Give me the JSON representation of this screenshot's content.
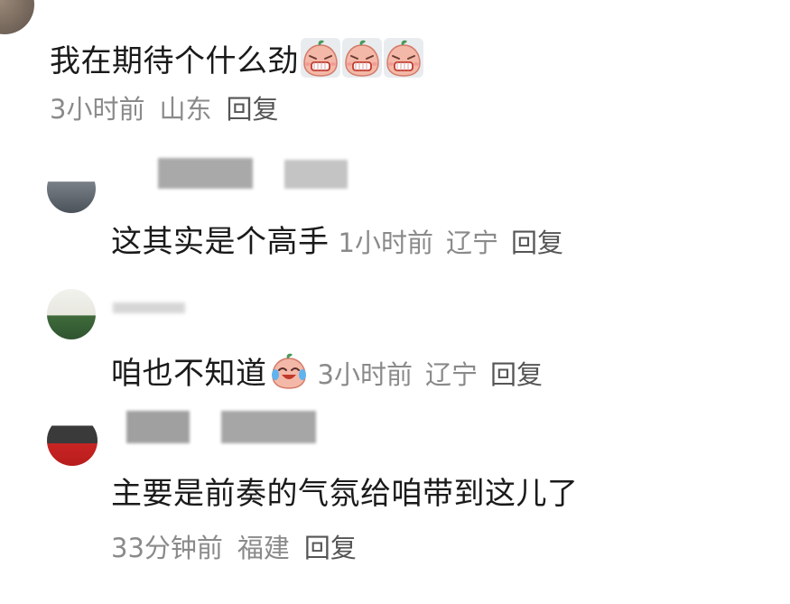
{
  "comments": [
    {
      "text": "我在期待个什么劲",
      "emojis": [
        "grimace-sticker",
        "grimace-sticker",
        "grimace-sticker"
      ],
      "time": "3小时前",
      "location": "山东",
      "reply": "回复"
    },
    {
      "text": "这其实是个高手",
      "time": "1小时前",
      "location": "辽宁",
      "reply": "回复"
    },
    {
      "text": "咱也不知道",
      "emojis": [
        "laugh-cry-sticker"
      ],
      "time": "3小时前",
      "location": "辽宁",
      "reply": "回复"
    },
    {
      "text": "主要是前奏的气氛给咱带到这儿了",
      "time": "33分钟前",
      "location": "福建",
      "reply": "回复"
    }
  ],
  "colors": {
    "text": "#1a1a1a",
    "meta": "#8a8a8a",
    "reply": "#555555",
    "sticker_face": "#f4b8a8",
    "sticker_leaf": "#4a9a5a"
  }
}
